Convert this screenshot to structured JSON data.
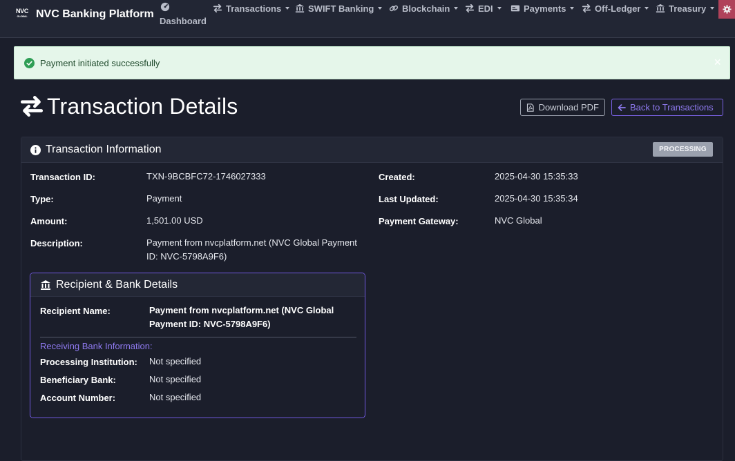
{
  "app": {
    "brand_logo_top": "NVC",
    "brand_logo_bottom": "GLOBAL",
    "brand_name": "NVC Banking Platform"
  },
  "nav": {
    "dashboard": "Dashboard",
    "items": [
      {
        "label": "Transactions",
        "icon": "arrows-exchange-icon"
      },
      {
        "label": "SWIFT Banking",
        "icon": "bank-icon"
      },
      {
        "label": "Blockchain",
        "icon": "link-icon"
      },
      {
        "label": "EDI",
        "icon": "arrows-exchange-icon"
      },
      {
        "label": "Payments",
        "icon": "credit-card-icon"
      },
      {
        "label": "Off-Ledger",
        "icon": "arrows-exchange-icon"
      },
      {
        "label": "Treasury",
        "icon": "bank-icon"
      }
    ]
  },
  "alert": {
    "message": "Payment initiated successfully",
    "close_glyph": "×"
  },
  "page": {
    "title": "Transaction Details",
    "download_pdf": "Download PDF",
    "back": "Back to Transactions"
  },
  "transaction": {
    "header": "Transaction Information",
    "status": "PROCESSING",
    "fields_left": [
      {
        "label": "Transaction ID:",
        "value": "TXN-9BCBFC72-1746027333"
      },
      {
        "label": "Type:",
        "value": "Payment"
      },
      {
        "label": "Amount:",
        "value": "1,501.00 USD"
      },
      {
        "label": "Description:",
        "value": "Payment from nvcplatform.net (NVC Global Payment ID: NVC-5798A9F6)"
      }
    ],
    "fields_right": [
      {
        "label": "Created:",
        "value": "2025-04-30 15:35:33"
      },
      {
        "label": "Last Updated:",
        "value": "2025-04-30 15:35:34"
      },
      {
        "label": "Payment Gateway:",
        "value": "NVC Global"
      }
    ]
  },
  "recipient": {
    "header": "Recipient & Bank Details",
    "name_label": "Recipient Name:",
    "name_value": "Payment from nvcplatform.net (NVC Global Payment ID: NVC-5798A9F6)",
    "bank_section": "Receiving Bank Information:",
    "fields": [
      {
        "label": "Processing Institution:",
        "value": "Not specified"
      },
      {
        "label": "Beneficiary Bank:",
        "value": "Not specified"
      },
      {
        "label": "Account Number:",
        "value": "Not specified"
      }
    ]
  },
  "colors": {
    "background": "#1b1e2b",
    "accent": "#7b62e6",
    "success_bg": "#e5f6ea",
    "status_badge": "#9ba1ae",
    "settings_button": "#b0425a"
  }
}
